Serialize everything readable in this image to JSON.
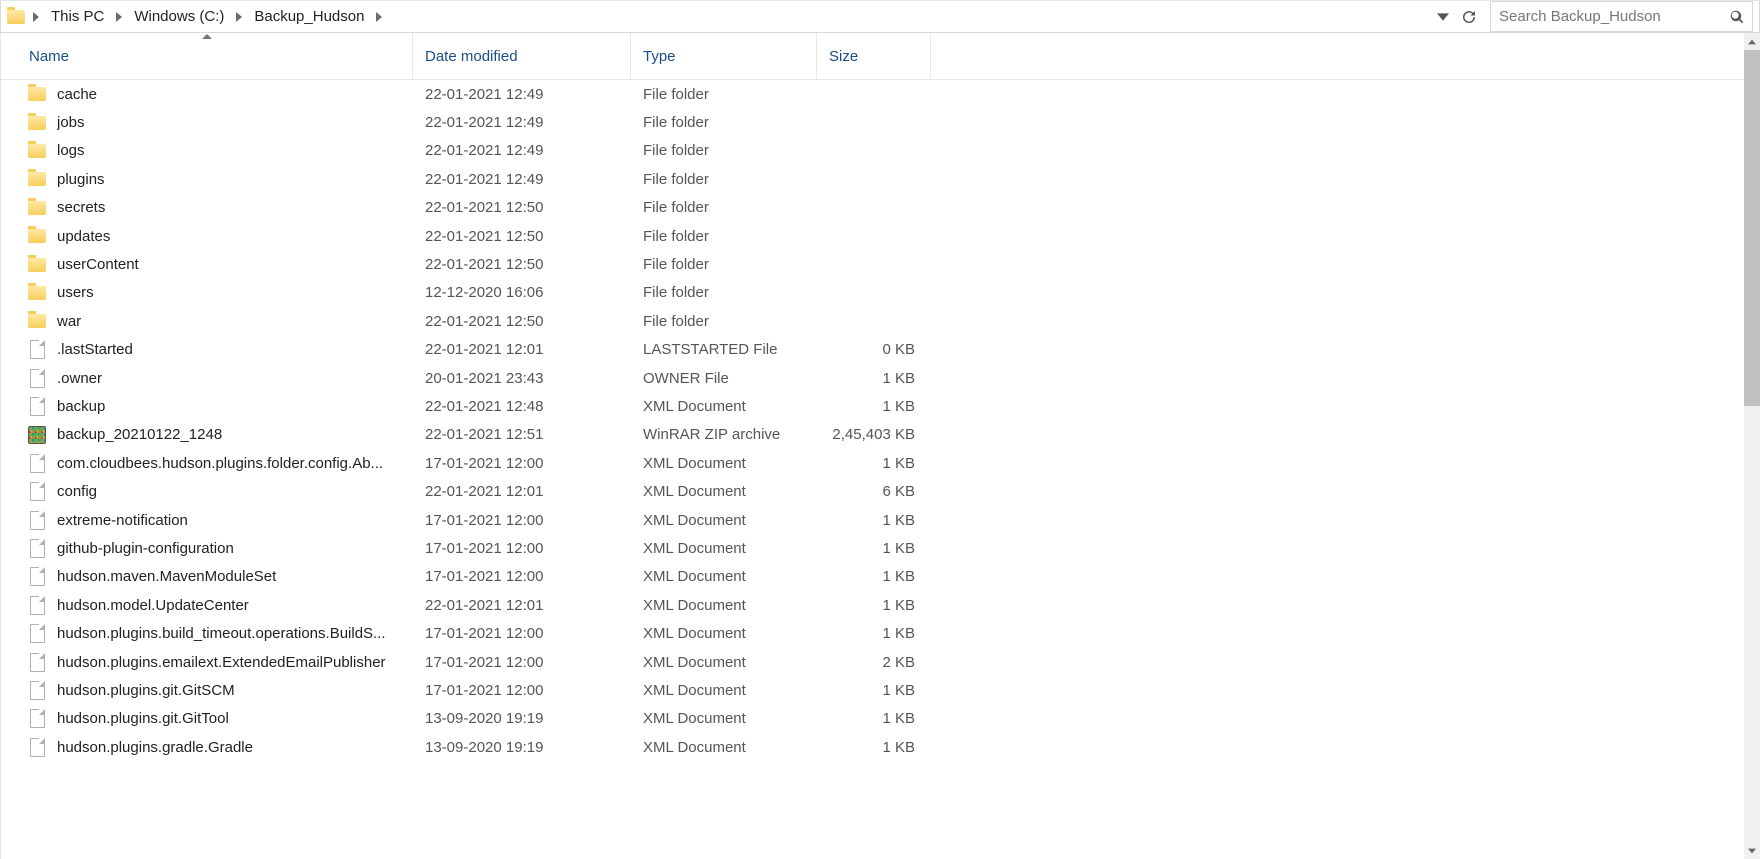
{
  "breadcrumb": {
    "items": [
      "This PC",
      "Windows (C:)",
      "Backup_Hudson"
    ]
  },
  "search": {
    "placeholder": "Search Backup_Hudson"
  },
  "columns": {
    "name": "Name",
    "date": "Date modified",
    "type": "Type",
    "size": "Size"
  },
  "rows": [
    {
      "icon": "folder",
      "name": "cache",
      "date": "22-01-2021 12:49",
      "type": "File folder",
      "size": ""
    },
    {
      "icon": "folder",
      "name": "jobs",
      "date": "22-01-2021 12:49",
      "type": "File folder",
      "size": ""
    },
    {
      "icon": "folder",
      "name": "logs",
      "date": "22-01-2021 12:49",
      "type": "File folder",
      "size": ""
    },
    {
      "icon": "folder",
      "name": "plugins",
      "date": "22-01-2021 12:49",
      "type": "File folder",
      "size": ""
    },
    {
      "icon": "folder",
      "name": "secrets",
      "date": "22-01-2021 12:50",
      "type": "File folder",
      "size": ""
    },
    {
      "icon": "folder",
      "name": "updates",
      "date": "22-01-2021 12:50",
      "type": "File folder",
      "size": ""
    },
    {
      "icon": "folder",
      "name": "userContent",
      "date": "22-01-2021 12:50",
      "type": "File folder",
      "size": ""
    },
    {
      "icon": "folder",
      "name": "users",
      "date": "12-12-2020 16:06",
      "type": "File folder",
      "size": ""
    },
    {
      "icon": "folder",
      "name": "war",
      "date": "22-01-2021 12:50",
      "type": "File folder",
      "size": ""
    },
    {
      "icon": "file",
      "name": ".lastStarted",
      "date": "22-01-2021 12:01",
      "type": "LASTSTARTED File",
      "size": "0 KB"
    },
    {
      "icon": "file",
      "name": ".owner",
      "date": "20-01-2021 23:43",
      "type": "OWNER File",
      "size": "1 KB"
    },
    {
      "icon": "file",
      "name": "backup",
      "date": "22-01-2021 12:48",
      "type": "XML Document",
      "size": "1 KB"
    },
    {
      "icon": "zip",
      "name": "backup_20210122_1248",
      "date": "22-01-2021 12:51",
      "type": "WinRAR ZIP archive",
      "size": "2,45,403 KB"
    },
    {
      "icon": "file",
      "name": "com.cloudbees.hudson.plugins.folder.config.Ab...",
      "date": "17-01-2021 12:00",
      "type": "XML Document",
      "size": "1 KB"
    },
    {
      "icon": "file",
      "name": "config",
      "date": "22-01-2021 12:01",
      "type": "XML Document",
      "size": "6 KB"
    },
    {
      "icon": "file",
      "name": "extreme-notification",
      "date": "17-01-2021 12:00",
      "type": "XML Document",
      "size": "1 KB"
    },
    {
      "icon": "file",
      "name": "github-plugin-configuration",
      "date": "17-01-2021 12:00",
      "type": "XML Document",
      "size": "1 KB"
    },
    {
      "icon": "file",
      "name": "hudson.maven.MavenModuleSet",
      "date": "17-01-2021 12:00",
      "type": "XML Document",
      "size": "1 KB"
    },
    {
      "icon": "file",
      "name": "hudson.model.UpdateCenter",
      "date": "22-01-2021 12:01",
      "type": "XML Document",
      "size": "1 KB"
    },
    {
      "icon": "file",
      "name": "hudson.plugins.build_timeout.operations.BuildS...",
      "date": "17-01-2021 12:00",
      "type": "XML Document",
      "size": "1 KB"
    },
    {
      "icon": "file",
      "name": "hudson.plugins.emailext.ExtendedEmailPublisher",
      "date": "17-01-2021 12:00",
      "type": "XML Document",
      "size": "2 KB"
    },
    {
      "icon": "file",
      "name": "hudson.plugins.git.GitSCM",
      "date": "17-01-2021 12:00",
      "type": "XML Document",
      "size": "1 KB"
    },
    {
      "icon": "file",
      "name": "hudson.plugins.git.GitTool",
      "date": "13-09-2020 19:19",
      "type": "XML Document",
      "size": "1 KB"
    },
    {
      "icon": "file",
      "name": "hudson.plugins.gradle.Gradle",
      "date": "13-09-2020 19:19",
      "type": "XML Document",
      "size": "1 KB"
    }
  ]
}
